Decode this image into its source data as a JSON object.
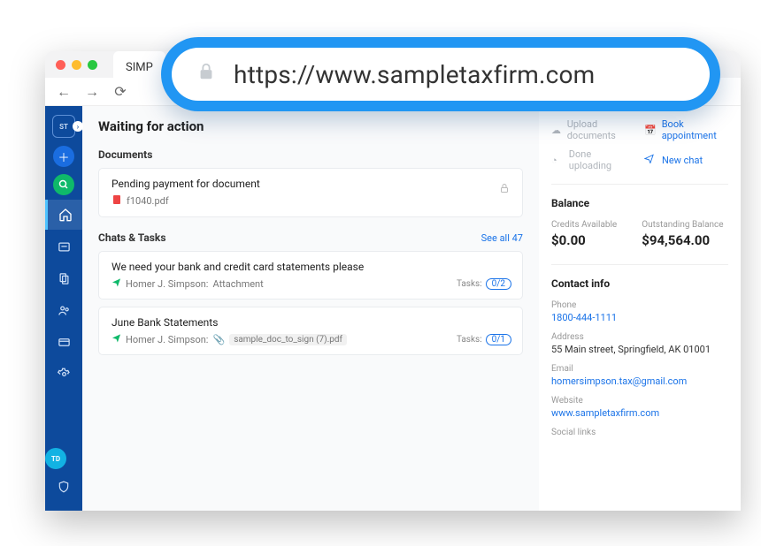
{
  "browser": {
    "tab_title": "SIMP",
    "url": "https://www.sampletaxfirm.com"
  },
  "sidebar": {
    "logo": "ST",
    "user_badge": "TD"
  },
  "page": {
    "title": "Waiting for action"
  },
  "documents": {
    "section_label": "Documents",
    "items": [
      {
        "title": "Pending payment for document",
        "file": "f1040.pdf",
        "file_type": "pdf",
        "locked": true
      }
    ]
  },
  "chats": {
    "section_label": "Chats & Tasks",
    "see_all": "See all 47",
    "items": [
      {
        "title": "We need your bank and credit card statements please",
        "author": "Homer J. Simpson:",
        "attachment_label": "Attachment",
        "tasks_label": "Tasks:",
        "tasks_count": "0/2"
      },
      {
        "title": "June Bank Statements",
        "author": "Homer J. Simpson:",
        "file_chip": "sample_doc_to_sign (7).pdf",
        "tasks_label": "Tasks:",
        "tasks_count": "0/1"
      }
    ]
  },
  "actions": {
    "upload": "Upload documents",
    "book": "Book appointment",
    "done": "Done uploading",
    "chat": "New chat"
  },
  "balance": {
    "title": "Balance",
    "credits_label": "Credits Available",
    "credits_value": "$0.00",
    "outstanding_label": "Outstanding Balance",
    "outstanding_value": "$94,564.00"
  },
  "contact": {
    "title": "Contact info",
    "phone_label": "Phone",
    "phone": "1800-444-1111",
    "address_label": "Address",
    "address": "55 Main street, Springfield, AK 01001",
    "email_label": "Email",
    "email": "homersimpson.tax@gmail.com",
    "website_label": "Website",
    "website": "www.sampletaxfirm.com",
    "social_label": "Social links"
  }
}
